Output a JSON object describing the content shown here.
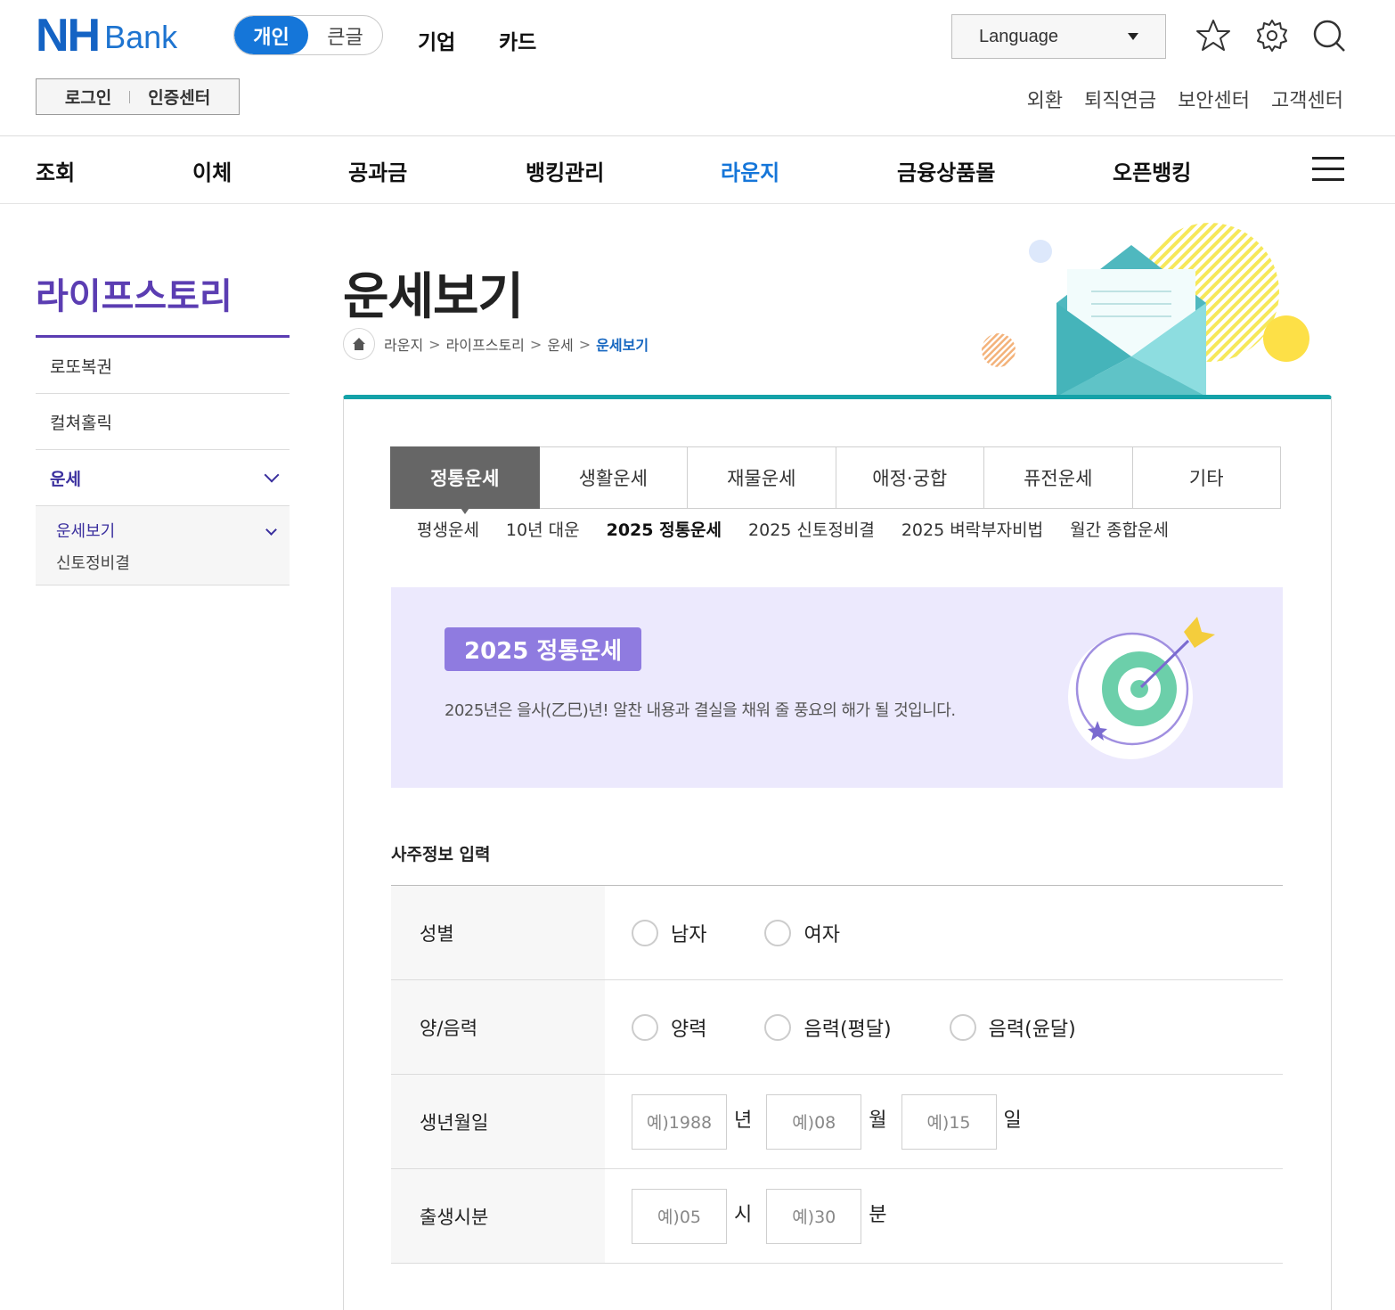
{
  "header": {
    "logo_nh": "NH",
    "logo_bank": "Bank",
    "seg_personal": "개인",
    "seg_bigtext": "큰글",
    "menu_corp": "기업",
    "menu_card": "카드",
    "language": "Language",
    "login": "로그인",
    "cert_center": "인증센터",
    "util": [
      "외환",
      "퇴직연금",
      "보안센터",
      "고객센터"
    ]
  },
  "gnb": [
    "조회",
    "이체",
    "공과금",
    "뱅킹관리",
    "라운지",
    "금융상품몰",
    "오픈뱅킹"
  ],
  "lnb": {
    "title": "라이프스토리",
    "items": [
      "로또복권",
      "컬쳐홀릭",
      "운세"
    ],
    "sub": [
      "운세보기",
      "신토정비결"
    ]
  },
  "page": {
    "title": "운세보기",
    "breadcrumb": [
      "라운지",
      "라이프스토리",
      "운세",
      "운세보기"
    ]
  },
  "tabs": [
    "정통운세",
    "생활운세",
    "재물운세",
    "애정·궁합",
    "퓨전운세",
    "기타"
  ],
  "subtabs": [
    "평생운세",
    "10년 대운",
    "2025 정통운세",
    "2025 신토정비결",
    "2025 벼락부자비법",
    "월간 종합운세"
  ],
  "banner": {
    "badge": "2025 정통운세",
    "desc": "2025년은 을사(乙巳)년! 알찬 내용과 결실을 채워 줄 풍요의 해가 될 것입니다."
  },
  "form": {
    "title": "사주정보 입력",
    "gender_label": "성별",
    "gender_options": [
      "남자",
      "여자"
    ],
    "calendar_label": "양/음력",
    "calendar_options": [
      "양력",
      "음력(평달)",
      "음력(윤달)"
    ],
    "birth_label": "생년월일",
    "birth_year_ph": "예)1988",
    "birth_year_unit": "년",
    "birth_month_ph": "예)08",
    "birth_month_unit": "월",
    "birth_day_ph": "예)15",
    "birth_day_unit": "일",
    "time_label": "출생시분",
    "hour_ph": "예)05",
    "hour_unit": "시",
    "min_ph": "예)30",
    "min_unit": "분"
  },
  "colors": {
    "brand_blue": "#1576d9",
    "lnb_purple": "#5b3db2",
    "content_top_border": "#14a2a8",
    "banner_bg": "#ece9fd",
    "badge_bg": "#8f7be0"
  }
}
